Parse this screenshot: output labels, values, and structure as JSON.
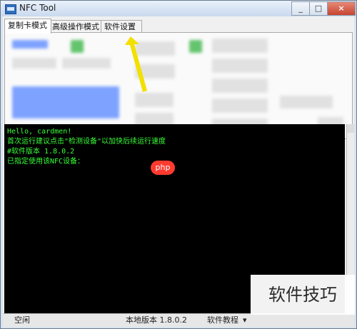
{
  "window": {
    "title": "NFC Tool",
    "controls": [
      "_",
      "□",
      "×"
    ]
  },
  "tabs": [
    {
      "label": "复制卡模式"
    },
    {
      "label": "高级操作模式"
    },
    {
      "label": "软件设置"
    }
  ],
  "console": {
    "lines": [
      "Hello, cardmen!",
      "首次运行建议点击\"检测设备\"以加快后续运行速度",
      "#软件版本 1.8.0.2",
      "已指定使用该NFC设备："
    ]
  },
  "status": {
    "left": "空闲",
    "version": "本地版本 1.8.0.2",
    "tutorial": "软件教程",
    "dropdown": "▾"
  },
  "badge": {
    "text": "php"
  },
  "watermark": {
    "text": "软件技巧"
  },
  "colors": {
    "title_bar": "#d0ddf0",
    "console_bg": "#000000",
    "console_text": "#39ff39"
  }
}
